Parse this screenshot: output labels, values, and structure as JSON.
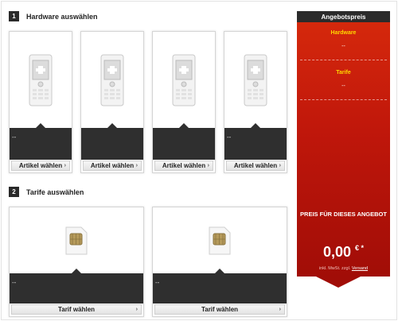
{
  "hardware": {
    "step": "1",
    "title": "Hardware auswählen",
    "items": [
      {
        "value": "--",
        "button": "Artikel wählen"
      },
      {
        "value": "",
        "button": "Artikel wählen"
      },
      {
        "value": "",
        "button": "Artikel wählen"
      },
      {
        "value": "--",
        "button": "Artikel wählen"
      }
    ]
  },
  "tarife": {
    "step": "2",
    "title": "Tarife auswählen",
    "items": [
      {
        "value": "--",
        "button": "Tarif wählen"
      },
      {
        "value": "--",
        "button": "Tarif wählen"
      }
    ]
  },
  "sidebar": {
    "header": "Angebotspreis",
    "hardware_label": "Hardware",
    "hardware_value": "--",
    "tarife_label": "Tarife",
    "tarife_value": "--",
    "promo": "PREIS FÜR DIESES ANGEBOT",
    "price": "0,00",
    "currency": "€",
    "asterisk": "*",
    "note_prefix": "inkl. MwSt. zzgl.",
    "note_link": "Versand"
  },
  "icons": {
    "chevron": "chevron-right-icon",
    "phone": "phone-icon",
    "sim": "sim-card-icon"
  },
  "colors": {
    "accent_red": "#c41a0a",
    "label_yellow": "#ffd800",
    "dark": "#2f2f2f"
  }
}
